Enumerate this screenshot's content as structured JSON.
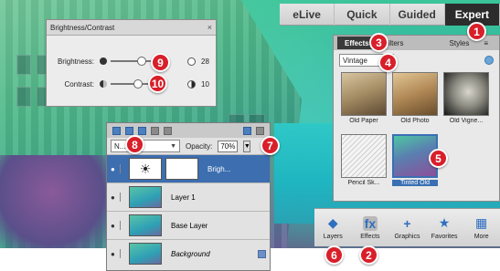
{
  "mode_bar": {
    "tabs": [
      {
        "label": "eLive",
        "active": false
      },
      {
        "label": "Quick",
        "active": false
      },
      {
        "label": "Guided",
        "active": false
      },
      {
        "label": "Expert",
        "active": true
      }
    ]
  },
  "effects_panel": {
    "tabs": [
      "Effects",
      "Filters",
      "Styles"
    ],
    "category": "Vintage",
    "thumbnails": [
      {
        "label": "Old Paper",
        "style": "sepia",
        "selected": false
      },
      {
        "label": "Old Photo",
        "style": "photo2",
        "selected": false
      },
      {
        "label": "Old Vigne...",
        "style": "vign",
        "selected": false
      },
      {
        "label": "Pencil Sk...",
        "style": "pencil",
        "selected": false
      },
      {
        "label": "Tinted Old",
        "style": "tinted",
        "selected": true
      }
    ]
  },
  "brightness_contrast": {
    "title": "Brightness/Contrast",
    "brightness_label": "Brightness:",
    "brightness_value": "28",
    "brightness_level": 0.62,
    "contrast_label": "Contrast:",
    "contrast_value": "10",
    "contrast_level": 0.55
  },
  "layers_panel": {
    "blend_mode": "N...",
    "opacity_label": "Opacity:",
    "opacity_value": "70%",
    "layers": [
      {
        "name": "Brigh...",
        "type": "adjustment",
        "selected": true
      },
      {
        "name": "Layer 1",
        "type": "pixel",
        "selected": false
      },
      {
        "name": "Base Layer",
        "type": "pixel",
        "selected": false
      },
      {
        "name": "Background",
        "type": "background",
        "selected": false
      }
    ]
  },
  "taskbar": {
    "items": [
      {
        "label": "Layers",
        "icon": "layers-icon",
        "glyph": "◆"
      },
      {
        "label": "Effects",
        "icon": "fx-icon",
        "glyph": "fx"
      },
      {
        "label": "Graphics",
        "icon": "plus-icon",
        "glyph": "+"
      },
      {
        "label": "Favorites",
        "icon": "star-icon",
        "glyph": "★"
      },
      {
        "label": "More",
        "icon": "more-icon",
        "glyph": "▦"
      }
    ]
  },
  "callouts": [
    "1",
    "2",
    "3",
    "4",
    "5",
    "6",
    "7",
    "8",
    "9",
    "10"
  ],
  "colors": {
    "badge": "#d81f2a",
    "selection": "#3c6eb0",
    "active_mode": "#2c2c2c"
  }
}
